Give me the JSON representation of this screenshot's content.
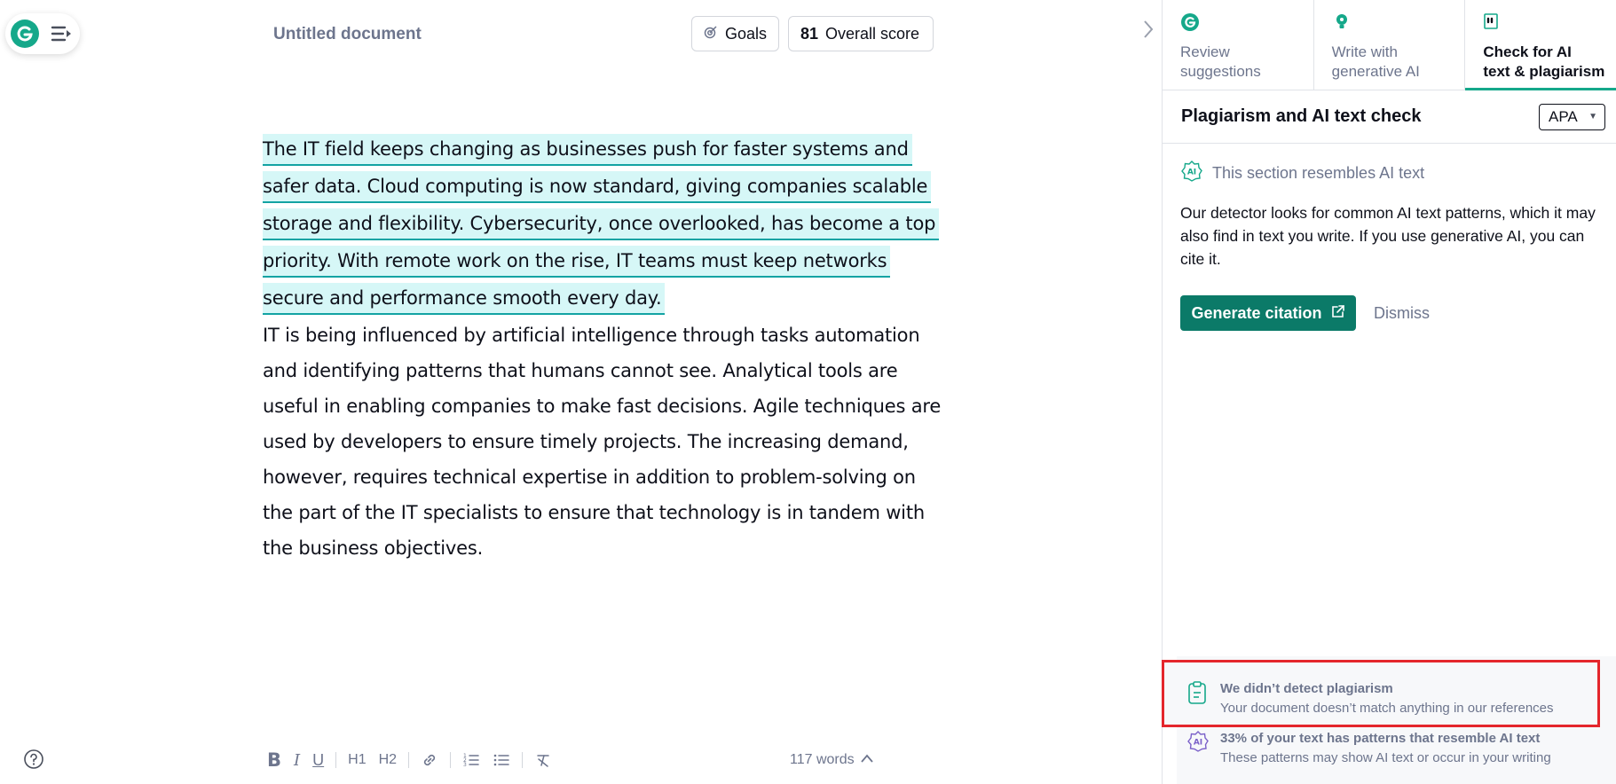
{
  "header": {
    "doc_title": "Untitled document",
    "goals_label": "Goals",
    "score_value": "81",
    "score_label": "Overall score"
  },
  "document": {
    "highlighted_lines": [
      "The IT field keeps changing as businesses push for faster systems and",
      "safer data. Cloud computing is now standard, giving companies scalable",
      "storage and flexibility. Cybersecurity, once overlooked, has become a top",
      "priority. With remote work on the rise, IT teams must keep networks",
      "secure and performance smooth every day."
    ],
    "plain_lines": [
      "IT is being influenced by artificial intelligence through tasks automation",
      "and identifying patterns that humans cannot see. Analytical tools are",
      "useful in enabling companies to make fast decisions. Agile techniques are",
      "used by developers to ensure timely projects. The increasing demand,",
      "however, requires technical expertise in addition to problem-solving on",
      "the part of the IT specialists to ensure that technology is in tandem with",
      "the business objectives."
    ],
    "highlight_color": "#d6f7f7",
    "underline_color": "#13a3a3"
  },
  "toolbar": {
    "bold": "B",
    "italic": "I",
    "underline": "U",
    "h1": "H1",
    "h2": "H2",
    "word_count": "117 words"
  },
  "panel": {
    "tabs": [
      {
        "line1": "Review",
        "line2": "suggestions",
        "icon": "grammarly-icon"
      },
      {
        "line1": "Write with",
        "line2": "generative AI",
        "icon": "lightbulb-icon"
      },
      {
        "line1": "Check for AI",
        "line2": "text & plagiarism",
        "icon": "quote-icon"
      }
    ],
    "title": "Plagiarism and AI text check",
    "citation_style": "APA",
    "section_note": "This section resembles AI text",
    "description": "Our detector looks for common AI text patterns, which it may also find in text you write. If you use generative AI, you can cite it.",
    "generate_label": "Generate citation",
    "dismiss_label": "Dismiss",
    "plagiarism_title": "We didn’t detect plagiarism",
    "plagiarism_sub": "Your document doesn’t match anything in our references",
    "ai_title": "33% of your text has patterns that resemble AI text",
    "ai_sub": "These patterns may show AI text or occur in your writing"
  },
  "colors": {
    "brand": "#15a88a",
    "button": "#0b7a68",
    "highlight_border": "#e4262c"
  }
}
